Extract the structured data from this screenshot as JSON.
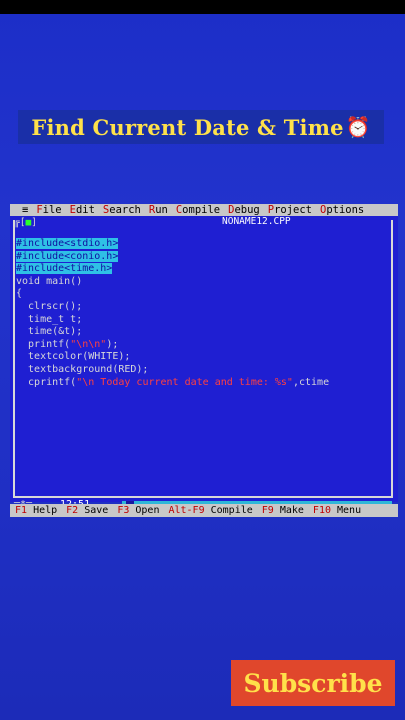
{
  "banner": {
    "title": "Find Current Date & Time",
    "icon": "alarm-clock-icon",
    "icon_glyph": "⏰"
  },
  "menubar": {
    "sys": "≡",
    "items": [
      {
        "hot": "F",
        "rest": "ile"
      },
      {
        "hot": "E",
        "rest": "dit"
      },
      {
        "hot": "S",
        "rest": "earch"
      },
      {
        "hot": "R",
        "rest": "un"
      },
      {
        "hot": "C",
        "rest": "ompile"
      },
      {
        "hot": "D",
        "rest": "ebug"
      },
      {
        "hot": "P",
        "rest": "roject"
      },
      {
        "hot": "O",
        "rest": "ptions"
      }
    ]
  },
  "editor": {
    "file_name": "NONAME12.CPP",
    "frame_left": "╔[",
    "frame_close": "■",
    "frame_right": "]",
    "code": [
      {
        "text": "#include<stdio.h>",
        "selected": true
      },
      {
        "text": "#include<conio.h>",
        "selected": true
      },
      {
        "text": "#include<time.h>",
        "selected": true
      },
      {
        "text": "void main()"
      },
      {
        "text": "{"
      },
      {
        "text": "  clrscr();"
      },
      {
        "text": "  time_t t;"
      },
      {
        "text": "  time(&t);"
      },
      {
        "prefix": "  printf(",
        "str": "\"\\n\\n\"",
        "suffix": ");"
      },
      {
        "text": "  textcolor(WHITE);"
      },
      {
        "text": "  textbackground(RED);"
      },
      {
        "prefix": "  cprintf(",
        "str": "\"\\n Today current date and time: %s\"",
        "suffix": ",ctime"
      }
    ],
    "cursor_pos": "12:51",
    "status_left": "═*═"
  },
  "keybar": [
    {
      "key": "F1",
      "label": "Help"
    },
    {
      "key": "F2",
      "label": "Save"
    },
    {
      "key": "F3",
      "label": "Open"
    },
    {
      "key": "Alt-F9",
      "label": "Compile"
    },
    {
      "key": "F9",
      "label": "Make"
    },
    {
      "key": "F10",
      "label": "Menu"
    }
  ],
  "subscribe": {
    "label": "Subscribe"
  },
  "colors": {
    "background": "#1f2fc4",
    "banner_text": "#ffe14a",
    "subscribe_bg": "#e0472c",
    "editor_bg": "#1f1fd2",
    "selection": "#2fc0e6"
  }
}
